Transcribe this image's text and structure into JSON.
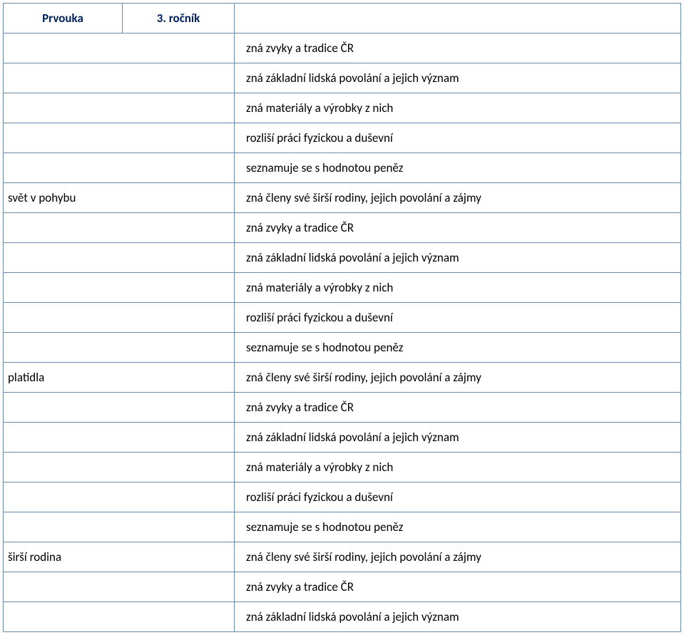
{
  "header": {
    "col1": "Prvouka",
    "col2": "3. ročník",
    "col3": ""
  },
  "rows": [
    {
      "left": "",
      "right": "zná zvyky a tradice ČR"
    },
    {
      "left": "",
      "right": "zná základní lidská povolání a jejich význam"
    },
    {
      "left": "",
      "right": "zná materiály a výrobky z nich"
    },
    {
      "left": "",
      "right": "rozliší práci fyzickou a duševní"
    },
    {
      "left": "",
      "right": "seznamuje se s hodnotou peněz"
    },
    {
      "left": "svět v pohybu",
      "right": "zná členy své širší rodiny, jejich povolání a zájmy"
    },
    {
      "left": "",
      "right": "zná zvyky a tradice ČR"
    },
    {
      "left": "",
      "right": "zná základní lidská povolání a jejich význam"
    },
    {
      "left": "",
      "right": "zná materiály a výrobky z nich"
    },
    {
      "left": "",
      "right": "rozliší práci fyzickou a duševní"
    },
    {
      "left": "",
      "right": "seznamuje se s hodnotou peněz"
    },
    {
      "left": "platidla",
      "right": "zná členy své širší rodiny, jejich povolání a zájmy"
    },
    {
      "left": "",
      "right": "zná zvyky a tradice ČR"
    },
    {
      "left": "",
      "right": "zná základní lidská povolání a jejich význam"
    },
    {
      "left": "",
      "right": "zná materiály a výrobky z nich"
    },
    {
      "left": "",
      "right": "rozliší práci fyzickou a duševní"
    },
    {
      "left": "",
      "right": "seznamuje se s hodnotou peněz"
    },
    {
      "left": "širší rodina",
      "right": "zná členy své širší rodiny, jejich povolání a zájmy"
    },
    {
      "left": "",
      "right": "zná zvyky a tradice ČR"
    },
    {
      "left": "",
      "right": "zná základní lidská povolání a jejich význam"
    }
  ]
}
